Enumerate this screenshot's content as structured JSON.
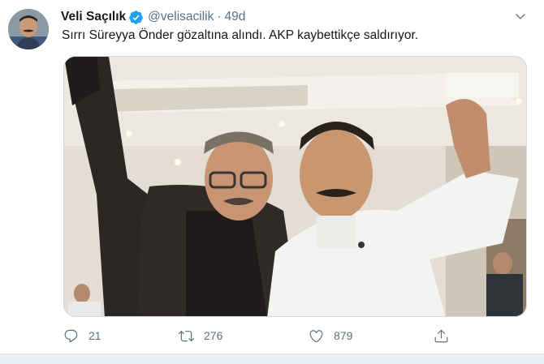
{
  "tweet": {
    "author_name": "Veli Saçılık",
    "verified": true,
    "handle": "@velisacilik",
    "separator": "·",
    "time": "49d",
    "text": "Sırrı Süreyya Önder gözaltına alındı. AKP kaybettikçe saldırıyor.",
    "photo_icon": "photo-two-men-raised-fists"
  },
  "actions": {
    "reply_count": "21",
    "retweet_count": "276",
    "like_count": "879",
    "reply_icon": "reply-icon",
    "retweet_icon": "retweet-icon",
    "like_icon": "heart-icon",
    "share_icon": "share-icon"
  },
  "colors": {
    "verified_badge": "#1da1f2",
    "secondary_text": "#5b7083",
    "primary_text": "#14171a"
  }
}
